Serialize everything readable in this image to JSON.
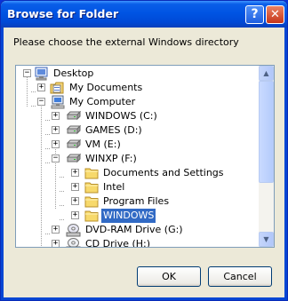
{
  "window": {
    "title": "Browse for Folder",
    "help_label": "?",
    "close_label": "✕"
  },
  "instruction": "Please choose the external Windows directory",
  "tree": {
    "items": [
      {
        "label": "Desktop",
        "expander": "−",
        "icon": "desktop-icon",
        "selected": false
      },
      {
        "label": "My Documents",
        "expander": "+",
        "icon": "my-documents-icon",
        "selected": false
      },
      {
        "label": "My Computer",
        "expander": "−",
        "icon": "my-computer-icon",
        "selected": false
      },
      {
        "label": "WINDOWS (C:)",
        "expander": "+",
        "icon": "hard-drive-icon",
        "selected": false
      },
      {
        "label": "GAMES (D:)",
        "expander": "+",
        "icon": "hard-drive-icon",
        "selected": false
      },
      {
        "label": "VM (E:)",
        "expander": "+",
        "icon": "hard-drive-icon",
        "selected": false
      },
      {
        "label": "WINXP (F:)",
        "expander": "−",
        "icon": "hard-drive-icon",
        "selected": false
      },
      {
        "label": "Documents and Settings",
        "expander": "+",
        "icon": "folder-icon",
        "selected": false
      },
      {
        "label": "Intel",
        "expander": "+",
        "icon": "folder-icon",
        "selected": false
      },
      {
        "label": "Program Files",
        "expander": "+",
        "icon": "folder-icon",
        "selected": false
      },
      {
        "label": "WINDOWS",
        "expander": "+",
        "icon": "folder-icon",
        "selected": true
      },
      {
        "label": "DVD-RAM Drive (G:)",
        "expander": "+",
        "icon": "dvd-drive-icon",
        "selected": false
      },
      {
        "label": "CD Drive (H:)",
        "expander": "+",
        "icon": "cd-drive-icon",
        "selected": false
      }
    ]
  },
  "buttons": {
    "ok": "OK",
    "cancel": "Cancel"
  },
  "colors": {
    "titlebar": "#0054e3",
    "selection": "#316ac5",
    "dialog_bg": "#ece9d8"
  }
}
